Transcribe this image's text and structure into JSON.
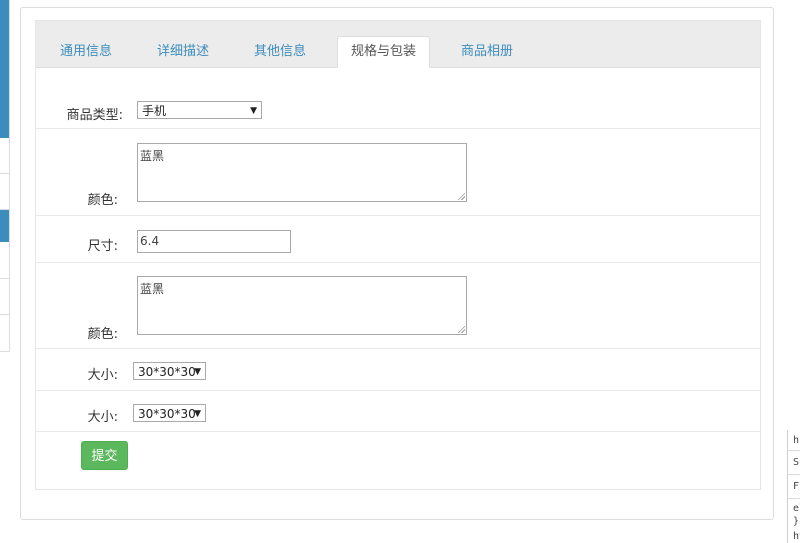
{
  "tabs": [
    {
      "label": "通用信息",
      "active": false
    },
    {
      "label": "详细描述",
      "active": false
    },
    {
      "label": "其他信息",
      "active": false
    },
    {
      "label": "规格与包装",
      "active": true
    },
    {
      "label": "商品相册",
      "active": false
    }
  ],
  "form": {
    "product_type": {
      "label": "商品类型:",
      "value": "手机"
    },
    "color1": {
      "label": "颜色:",
      "value": "蓝黑"
    },
    "size": {
      "label": "尺寸:",
      "value": "6.4"
    },
    "color2": {
      "label": "颜色:",
      "value": "蓝黑"
    },
    "dim1": {
      "label": "大小:",
      "value": "30*30*30"
    },
    "dim2": {
      "label": "大小:",
      "value": "30*30*30"
    },
    "submit_label": "提交"
  },
  "devtools_fragment": {
    "line1": "h",
    "line2": "S",
    "line3": "F",
    "line4": "el",
    "line5": "}",
    "line6": "ht"
  },
  "colors": {
    "tab_link": "#3c8dbc",
    "submit_bg": "#5cb85c",
    "sidebar_accent": "#3c8dbc"
  }
}
